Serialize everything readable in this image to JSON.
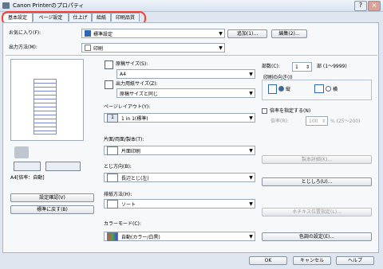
{
  "window": {
    "title": "Canon Printerのプロパティ",
    "controls": {
      "close": "×",
      "help": "?"
    }
  },
  "tabs": [
    {
      "label": "基本設定"
    },
    {
      "label": "ページ設定"
    },
    {
      "label": "仕上げ"
    },
    {
      "label": "給紙"
    },
    {
      "label": "印刷品質"
    }
  ],
  "favorites": {
    "label": "お気に入り(F):",
    "value": "標準設定",
    "add_label": "追加(1)...",
    "edit_label": "編集(2)..."
  },
  "output_method": {
    "label": "出力方法(M):",
    "value": "印刷"
  },
  "paper": {
    "original_label": "原稿サイズ(S):",
    "original_value": "A4",
    "output_label": "出力用紙サイズ(Z):",
    "output_value": "原稿サイズと同じ"
  },
  "copies": {
    "label": "部数(C):",
    "value": "1",
    "unit": "部 (1〜9999)"
  },
  "orientation": {
    "label": "印刷の向き(I)",
    "portrait": "縦",
    "landscape": "横"
  },
  "scaling": {
    "label": "倍率を指定する(N)",
    "rate_label": "倍率(R):",
    "rate_value": "100",
    "unit": "% (25〜200)"
  },
  "layout": {
    "label": "ページレイアウト(Y):",
    "value": "1 in 1(標準)"
  },
  "duplex": {
    "label": "片面/両面/製本(T):",
    "value": "片面印刷",
    "binding_label": "製本詳細(K)..."
  },
  "binding": {
    "label": "とじ方向(B):",
    "value": "長辺とじ(左)",
    "margin_label": "とじしろ(U)..."
  },
  "discharge": {
    "label": "排紙方法(H):",
    "value": "ソート",
    "staple_label": "ホチキス位置指定(L)..."
  },
  "color": {
    "label": "カラーモード(C):",
    "value": "自動(カラー/白黒)",
    "detail_label": "色調の設定(E)..."
  },
  "preview": {
    "caption": "A4[倍率：自動]",
    "settings_button": "設定確認(V)",
    "restore_button": "標準に戻す(B)"
  },
  "footer": {
    "ok": "OK",
    "cancel": "キャンセル",
    "help": "ヘルプ"
  },
  "colors": {
    "accent": "#2f67b8",
    "highlight_box": "#ff3b2d"
  }
}
